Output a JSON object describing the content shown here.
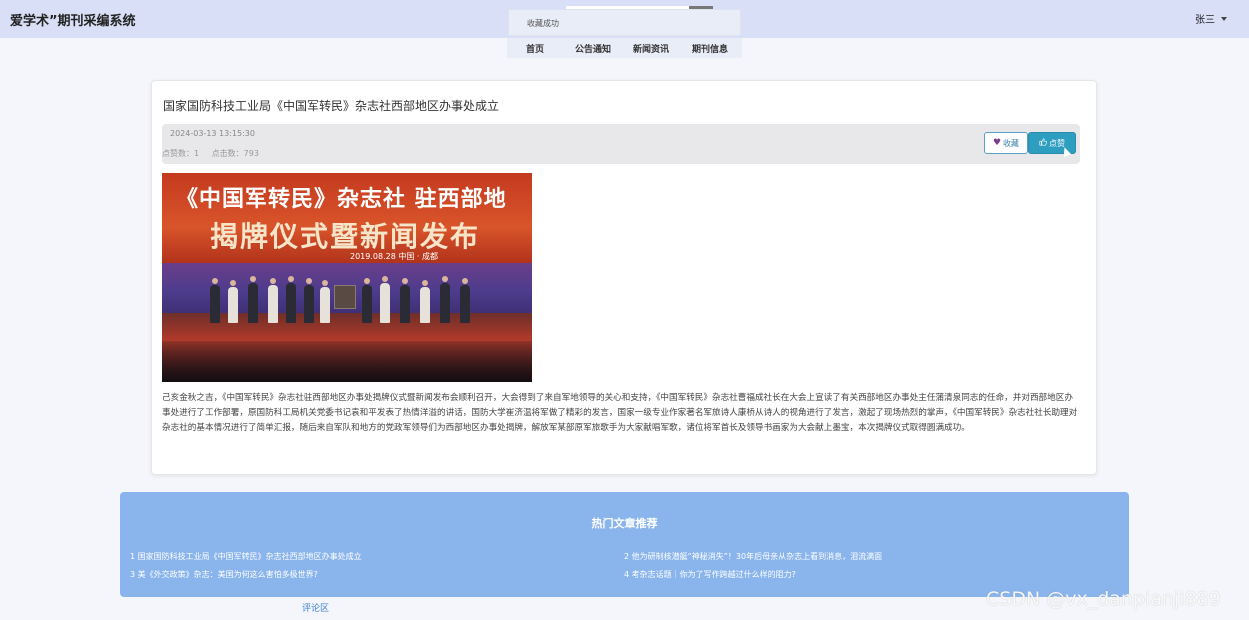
{
  "header": {
    "brand": "爱学术”期刊采编系统",
    "user_name": "张三"
  },
  "toast": {
    "message": "收藏成功"
  },
  "nav": {
    "items": [
      "首页",
      "公告通知",
      "新闻资讯",
      "期刊信息"
    ]
  },
  "article": {
    "title": "国家国防科技工业局《中国军转民》杂志社西部地区办事处成立",
    "date": "2024-03-13 13:15:30",
    "likes": "点赞数：1",
    "clicks": "点击数：793",
    "favorite_label": "收藏",
    "like_label": "点赞",
    "image": {
      "banner_line1": "《中国军转民》杂志社  驻西部地",
      "banner_line2": "揭牌仪式暨新闻发布",
      "banner_date": "2019.08.28   中国 · 成都"
    },
    "body": "己亥金秋之吉，《中国军转民》杂志社驻西部地区办事处揭牌仪式暨新闻发布会顺利召开，大会得到了来自军地领导的关心和支持，《中国军转民》杂志社曹福成社长在大会上宣读了有关西部地区办事处主任蒲清泉同志的任命，并对西部地区办事处进行了工作部署，原国防科工局机关党委书记袁和平发表了热情洋溢的讲话，国防大学崔济温将军做了精彩的发言，国家一级专业作家著名军旅诗人康桥从诗人的视角进行了发言，激起了现场热烈的掌声，《中国军转民》杂志社社长助理对杂志社的基本情况进行了简单汇报，随后来自军队和地方的党政军领导们为西部地区办事处揭牌，解放军某部原军旅歌手为大家献唱军歌，诸位将军首长及领导书画家为大会献上墨宝，本次揭牌仪式取得圆满成功。"
  },
  "hot": {
    "title": "热门文章推荐",
    "items": [
      "1  国家国防科技工业局《中国军转民》杂志社西部地区办事处成立",
      "2  他为研制核潜艇“神秘消失”！30年后母亲从杂志上看到消息，泪流满面",
      "3  美《外交政策》杂志：美国为何这么害怕多极世界?",
      "4  考杂志话题｜你为了写作跨越过什么样的阻力?"
    ]
  },
  "comments": {
    "label": "评论区"
  },
  "watermark": "CSDN @vx_danpianji889",
  "colors": {
    "topbar": "#d8dff6",
    "hot_panel": "#8ab4ec",
    "like_button": "#2e9ec0",
    "favorite_border": "#5aa0c8"
  }
}
